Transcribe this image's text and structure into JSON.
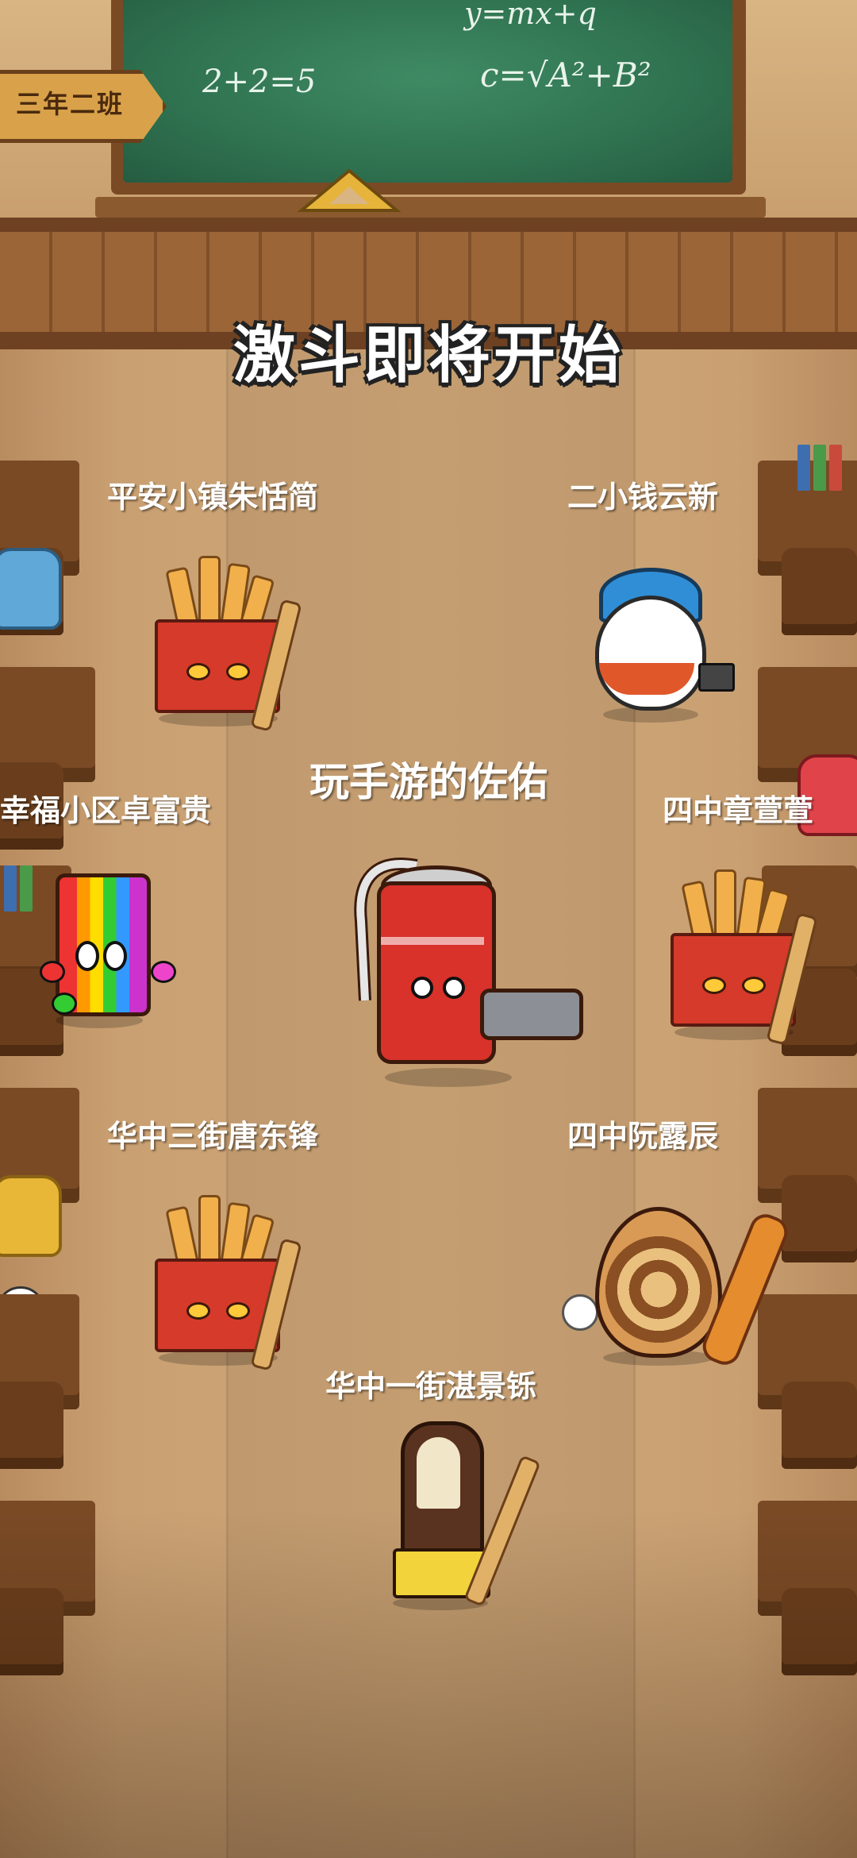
{
  "classroom": {
    "class_sign": "三年二班",
    "chalkboard": {
      "formula_1": "y=mx+q",
      "formula_2": "2+2=5",
      "formula_3": "c=√A²+B²"
    }
  },
  "banner": {
    "title": "激斗即将开始"
  },
  "players": [
    {
      "name": "平安小镇朱恬简",
      "character": "fries"
    },
    {
      "name": "二小钱云新",
      "character": "cap-egg"
    },
    {
      "name": "玩手游的佐佑",
      "character": "soda-can",
      "is_self": true
    },
    {
      "name": "幸福小区卓富贵",
      "character": "candy-cup"
    },
    {
      "name": "四中章萱萱",
      "character": "fries"
    },
    {
      "name": "华中三街唐东锋",
      "character": "fries"
    },
    {
      "name": "四中阮露辰",
      "character": "cone"
    },
    {
      "name": "华中一街湛景铄",
      "character": "popsicle"
    }
  ]
}
